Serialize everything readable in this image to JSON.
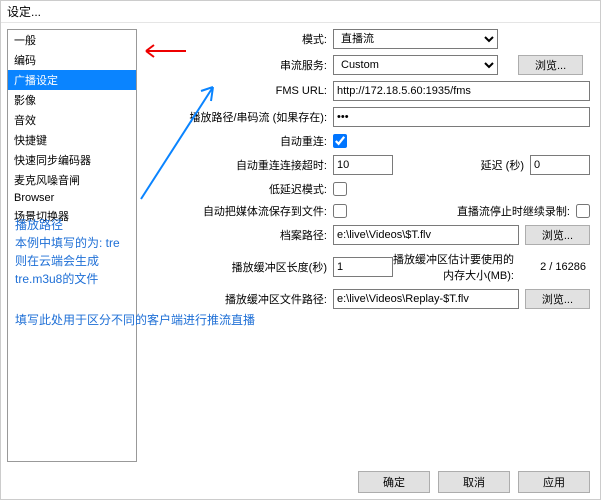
{
  "title": "设定...",
  "sidebar": [
    "一般",
    "编码",
    "广播设定",
    "影像",
    "音效",
    "快捷键",
    "快速同步编码器",
    "麦克风噪音闸",
    "Browser",
    "场景切换器"
  ],
  "labels": {
    "mode": "模式:",
    "service": "串流服务:",
    "fms": "FMS URL:",
    "path": "播放路径/串码流 (如果存在):",
    "auto": "自动重连:",
    "retry": "自动重连连接超时:",
    "lowlat": "低延迟模式:",
    "save": "自动把媒体流保存到文件:",
    "arch": "档案路径:",
    "buflen": "播放缓冲区长度(秒)",
    "est": "播放缓冲区估计要使用的内存大小(MB):",
    "bufpath": "播放缓冲区文件路径:",
    "delay": "延迟 (秒)",
    "keeprec": "直播流停止时继续录制:"
  },
  "values": {
    "mode": "直播流",
    "service": "Custom",
    "fms": "http://172.18.5.60:1935/fms",
    "path": "•••",
    "retry": "10",
    "delay": "0",
    "arch": "e:\\live\\Videos\\$T.flv",
    "buflen": "1",
    "est": "2 / 16286",
    "bufpath": "e:\\live\\Videos\\Replay-$T.flv"
  },
  "btns": {
    "browse": "浏览...",
    "ok": "确定",
    "cancel": "取消",
    "apply": "应用"
  },
  "notes": {
    "a": "播放路径\n本例中填写的为: tre\n则在云端会生成\ntre.m3u8的文件",
    "b": "填写此处用于区分不同的客户端进行推流直播"
  }
}
